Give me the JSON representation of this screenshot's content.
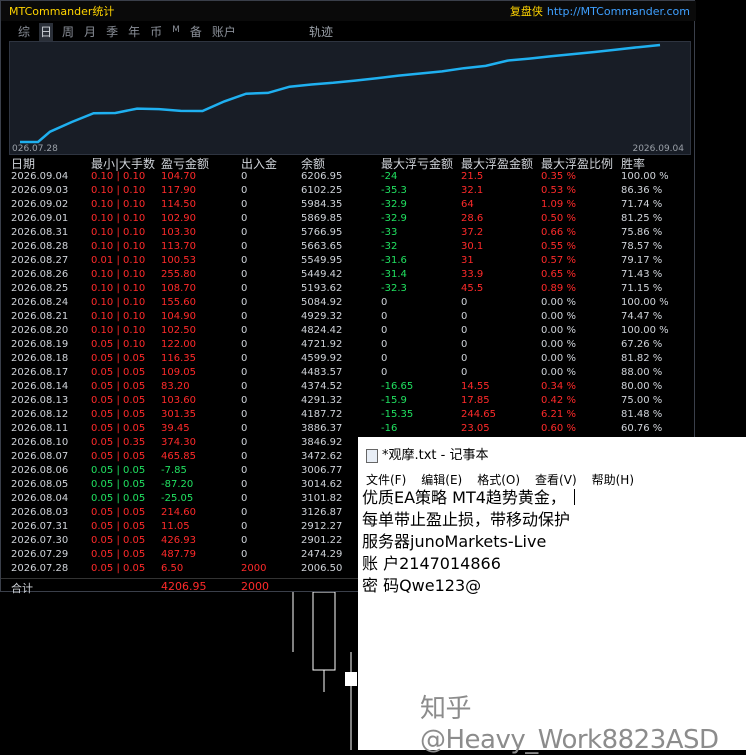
{
  "app": {
    "title": "MTCommander统计",
    "brand_name": "复盘侠",
    "brand_url": "http://MTCommander.com"
  },
  "tabs": [
    "综",
    "日",
    "周",
    "月",
    "季",
    "年",
    "币",
    "M",
    "备",
    "账户"
  ],
  "active_tab": "日",
  "chart": {
    "label": "轨迹",
    "start_date": "026.07.28",
    "end_date": "2026.09.04",
    "line_color": "#1fb0f0"
  },
  "table": {
    "headers": [
      "日期",
      "最小|大手数",
      "盈亏金额",
      "出入金",
      "余额",
      "最大浮亏金额",
      "最大浮盈金额",
      "最大浮盈比例",
      "胜率"
    ],
    "rows": [
      [
        "2026.09.04",
        "0.10 | 0.10",
        "104.70",
        "0",
        "6206.95",
        "-24",
        "21.5",
        "0.35 %",
        "100.00 %"
      ],
      [
        "2026.09.03",
        "0.10 | 0.10",
        "117.90",
        "0",
        "6102.25",
        "-35.3",
        "32.1",
        "0.53 %",
        "86.36 %"
      ],
      [
        "2026.09.02",
        "0.10 | 0.10",
        "114.50",
        "0",
        "5984.35",
        "-32.9",
        "64",
        "1.09 %",
        "71.74 %"
      ],
      [
        "2026.09.01",
        "0.10 | 0.10",
        "102.90",
        "0",
        "5869.85",
        "-32.9",
        "28.6",
        "0.50 %",
        "81.25 %"
      ],
      [
        "2026.08.31",
        "0.10 | 0.10",
        "103.30",
        "0",
        "5766.95",
        "-33",
        "37.2",
        "0.66 %",
        "75.86 %"
      ],
      [
        "2026.08.28",
        "0.10 | 0.10",
        "113.70",
        "0",
        "5663.65",
        "-32",
        "30.1",
        "0.55 %",
        "78.57 %"
      ],
      [
        "2026.08.27",
        "0.01 | 0.10",
        "100.53",
        "0",
        "5549.95",
        "-31.6",
        "31",
        "0.57 %",
        "79.17 %"
      ],
      [
        "2026.08.26",
        "0.10 | 0.10",
        "255.80",
        "0",
        "5449.42",
        "-31.4",
        "33.9",
        "0.65 %",
        "71.43 %"
      ],
      [
        "2026.08.25",
        "0.10 | 0.10",
        "108.70",
        "0",
        "5193.62",
        "-32.3",
        "45.5",
        "0.89 %",
        "71.15 %"
      ],
      [
        "2026.08.24",
        "0.10 | 0.10",
        "155.60",
        "0",
        "5084.92",
        "0",
        "0",
        "0.00 %",
        "100.00 %"
      ],
      [
        "2026.08.21",
        "0.10 | 0.10",
        "104.90",
        "0",
        "4929.32",
        "0",
        "0",
        "0.00 %",
        "74.47 %"
      ],
      [
        "2026.08.20",
        "0.10 | 0.10",
        "102.50",
        "0",
        "4824.42",
        "0",
        "0",
        "0.00 %",
        "100.00 %"
      ],
      [
        "2026.08.19",
        "0.05 | 0.10",
        "122.00",
        "0",
        "4721.92",
        "0",
        "0",
        "0.00 %",
        "67.26 %"
      ],
      [
        "2026.08.18",
        "0.05 | 0.05",
        "116.35",
        "0",
        "4599.92",
        "0",
        "0",
        "0.00 %",
        "81.82 %"
      ],
      [
        "2026.08.17",
        "0.05 | 0.05",
        "109.05",
        "0",
        "4483.57",
        "0",
        "0",
        "0.00 %",
        "88.00 %"
      ],
      [
        "2026.08.14",
        "0.05 | 0.05",
        "83.20",
        "0",
        "4374.52",
        "-16.65",
        "14.55",
        "0.34 %",
        "80.00 %"
      ],
      [
        "2026.08.13",
        "0.05 | 0.05",
        "103.60",
        "0",
        "4291.32",
        "-15.9",
        "17.85",
        "0.42 %",
        "75.00 %"
      ],
      [
        "2026.08.12",
        "0.05 | 0.05",
        "301.35",
        "0",
        "4187.72",
        "-15.35",
        "244.65",
        "6.21 %",
        "81.48 %"
      ],
      [
        "2026.08.11",
        "0.05 | 0.05",
        "39.45",
        "0",
        "3886.37",
        "-16",
        "23.05",
        "0.60 %",
        "60.76 %"
      ],
      [
        "2026.08.10",
        "0.05 | 0.35",
        "374.30",
        "0",
        "3846.92",
        "",
        "",
        "",
        ""
      ],
      [
        "2026.08.07",
        "0.05 | 0.05",
        "465.85",
        "0",
        "3472.62",
        "",
        "",
        "",
        ""
      ],
      [
        "2026.08.06",
        "0.05 | 0.05",
        "-7.85",
        "0",
        "3006.77",
        "",
        "",
        "",
        ""
      ],
      [
        "2026.08.05",
        "0.05 | 0.05",
        "-87.20",
        "0",
        "3014.62",
        "",
        "",
        "",
        ""
      ],
      [
        "2026.08.04",
        "0.05 | 0.05",
        "-25.05",
        "0",
        "3101.82",
        "",
        "",
        "",
        ""
      ],
      [
        "2026.08.03",
        "0.05 | 0.05",
        "214.60",
        "0",
        "3126.87",
        "",
        "",
        "",
        ""
      ],
      [
        "2026.07.31",
        "0.05 | 0.05",
        "11.05",
        "0",
        "2912.27",
        "",
        "",
        "",
        ""
      ],
      [
        "2026.07.30",
        "0.05 | 0.05",
        "426.93",
        "0",
        "2901.22",
        "",
        "",
        "",
        ""
      ],
      [
        "2026.07.29",
        "0.05 | 0.05",
        "487.79",
        "0",
        "2474.29",
        "",
        "",
        "",
        ""
      ],
      [
        "2026.07.28",
        "0.05 | 0.05",
        "6.50",
        "2000",
        "2006.50",
        "",
        "",
        "",
        ""
      ]
    ],
    "summary": {
      "label": "合计",
      "pnl": "4206.95",
      "deposit": "2000"
    }
  },
  "notepad": {
    "title": "*观摩.txt - 记事本",
    "menu": [
      "文件(F)",
      "编辑(E)",
      "格式(O)",
      "查看(V)",
      "帮助(H)"
    ],
    "lines": [
      "优质EA策略  MT4趋势黄金，",
      "每单带止盈止损，带移动保护",
      "服务器junoMarkets-Live",
      "账 户2147014866",
      "密 码Qwe123@"
    ]
  },
  "watermark": "知乎 @Heavy_Work8823ASD"
}
